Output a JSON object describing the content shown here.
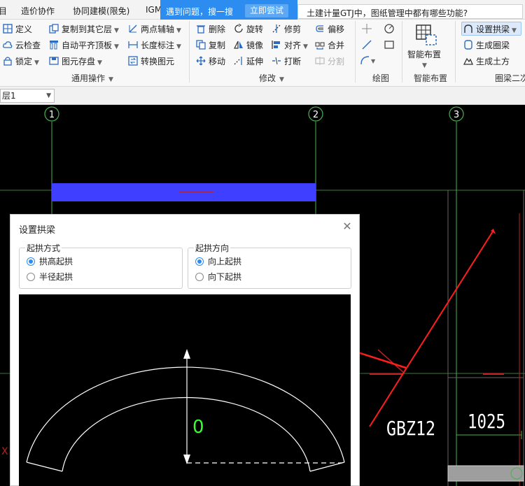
{
  "tabs": [
    "目",
    "造价协作",
    "协同建模(限免)",
    "IGM"
  ],
  "search": {
    "prompt": "遇到问题，搜一搜",
    "try_button": "立即尝试"
  },
  "tip": "土建计量GTJ中，图纸管理中都有哪些功能?",
  "ribbon": {
    "general": {
      "define": "定义",
      "copy_to_layer": "复制到其它层",
      "two_point_axis": "两点辅轴",
      "cloud_check": "云检查",
      "auto_flat_top": "自动平齐顶板",
      "length_dim": "长度标注",
      "lock": "锁定",
      "element_storage": "图元存盘",
      "convert_element": "转换图元",
      "group_label": "通用操作"
    },
    "modify": {
      "delete": "删除",
      "rotate": "旋转",
      "trim": "修剪",
      "offset": "偏移",
      "copy": "复制",
      "mirror": "镜像",
      "align": "对齐",
      "merge": "合并",
      "move": "移动",
      "extend": "延伸",
      "break": "打断",
      "split": "分割",
      "group_label": "修改"
    },
    "draw": {
      "group_label": "绘图"
    },
    "smart": {
      "label": "智能布置",
      "group_label": "智能布置"
    },
    "ring_beam": {
      "set_arch": "设置拱梁",
      "gen_ring_beam": "生成圈梁",
      "gen_earthwork": "生成土方",
      "group_label": "圈梁二次"
    }
  },
  "layer": {
    "selected": "层1"
  },
  "canvas": {
    "axis_labels": [
      "1",
      "2",
      "3"
    ],
    "component_label": "GBZ12",
    "dimension": "1025",
    "colors": {
      "background": "#000000",
      "grid": "#4caf50",
      "beam": "#3f3fff",
      "arrow": "#ff1e1e"
    }
  },
  "dialog": {
    "title": "设置拱梁",
    "arch_mode": {
      "legend": "起拱方式",
      "options": [
        "拱高起拱",
        "半径起拱"
      ],
      "selected": 0
    },
    "arch_direction": {
      "legend": "起拱方向",
      "options": [
        "向上起拱",
        "向下起拱"
      ],
      "selected": 0
    },
    "preview_value": "0"
  },
  "colors": {
    "accent": "#2d8cf0"
  }
}
